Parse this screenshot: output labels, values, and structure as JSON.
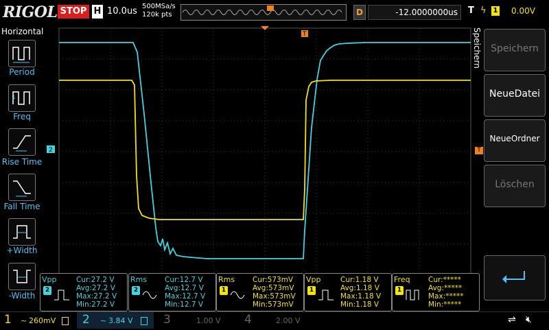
{
  "header": {
    "brand": "RIGOL",
    "run_state": "STOP",
    "timebase_label": "H",
    "timebase_value": "10.0us",
    "sample_rate": "500MSa/s",
    "memory_depth": "120k pts",
    "delay_label": "D",
    "delay_value": "-12.0000000us",
    "trigger_label": "T",
    "trigger_source": "1",
    "trigger_level": "0.00V"
  },
  "left_menu": {
    "title": "Horizontal",
    "items": [
      {
        "label": "Period",
        "icon": "period-icon"
      },
      {
        "label": "Freq",
        "icon": "freq-icon"
      },
      {
        "label": "Rise Time",
        "icon": "rise-time-icon"
      },
      {
        "label": "Fall Time",
        "icon": "fall-time-icon"
      },
      {
        "label": "+Width",
        "icon": "pos-width-icon"
      },
      {
        "label": "-Width",
        "icon": "neg-width-icon"
      }
    ]
  },
  "right_menu": {
    "title": "Speichern",
    "buttons": [
      {
        "label": "Speichern",
        "enabled": false
      },
      {
        "label": "NeueDatei",
        "enabled": true
      },
      {
        "label": "NeueOrdner",
        "enabled": true
      },
      {
        "label": "Löschen",
        "enabled": false
      },
      {
        "label": "return",
        "icon": "return-arrow-icon",
        "enabled": true
      }
    ]
  },
  "markers": {
    "ch2_level_marker": "2",
    "trigger_level_marker": "T",
    "trigger_position_marker": "T"
  },
  "measurements": [
    {
      "name": "Vpp",
      "channel": "2",
      "cur": "27.2 V",
      "avg": "27.2 V",
      "max": "27.2 V",
      "min": "27.2 V"
    },
    {
      "name": "Rms",
      "channel": "2",
      "cur": "12.7 V",
      "avg": "12.7 V",
      "max": "12.7 V",
      "min": "12.7 V"
    },
    {
      "name": "Rms",
      "channel": "1",
      "cur": "573mV",
      "avg": "573mV",
      "max": "573mV",
      "min": "573mV"
    },
    {
      "name": "Vpp",
      "channel": "1",
      "cur": "1.18 V",
      "avg": "1.18 V",
      "max": "1.18 V",
      "min": "1.18 V"
    },
    {
      "name": "Freq",
      "channel": "1",
      "cur": "*****",
      "avg": "*****",
      "max": "*****",
      "min": "*****"
    }
  ],
  "measurement_labels": {
    "cur": "Cur:",
    "avg": "Avg:",
    "max": "Max:",
    "min": "Min:"
  },
  "channels": [
    {
      "num": "1",
      "scale": "260mV",
      "coupling": "~",
      "active": true
    },
    {
      "num": "2",
      "scale": "3.84 V",
      "coupling": "~",
      "active": true
    },
    {
      "num": "3",
      "scale": "1.00 V",
      "active": false
    },
    {
      "num": "4",
      "scale": "2.00 V",
      "active": false
    }
  ],
  "colors": {
    "ch1": "#f5e400",
    "ch2": "#3fd4e0",
    "trigger": "#f08020",
    "stop": "#d91e1e"
  }
}
